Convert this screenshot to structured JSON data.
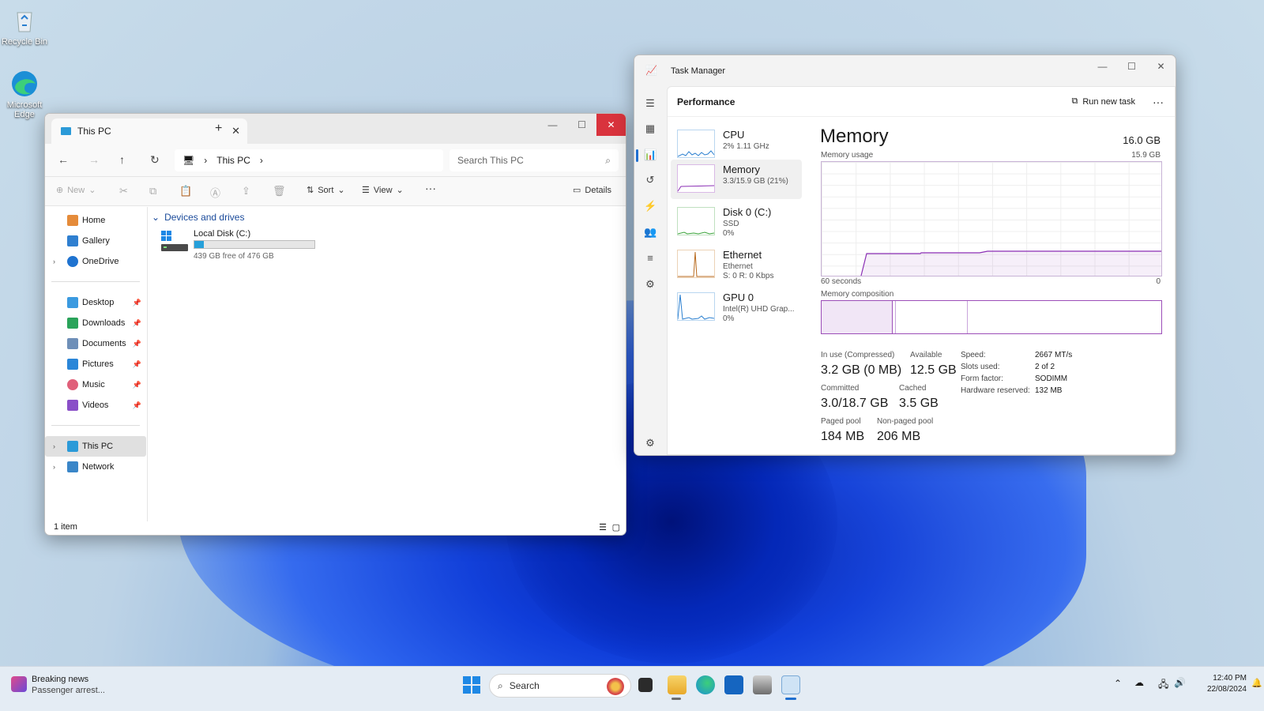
{
  "desktop": {
    "icons": [
      {
        "label": "Recycle Bin"
      },
      {
        "label": "Microsoft Edge"
      }
    ]
  },
  "explorer": {
    "tab_title": "This PC",
    "address_crumb": "This PC",
    "search_placeholder": "Search This PC",
    "commands": {
      "new": "New",
      "sort": "Sort",
      "view": "View",
      "details": "Details"
    },
    "sidebar": {
      "top": [
        "Home",
        "Gallery",
        "OneDrive"
      ],
      "pinned": [
        "Desktop",
        "Downloads",
        "Documents",
        "Pictures",
        "Music",
        "Videos"
      ],
      "bottom": [
        "This PC",
        "Network"
      ]
    },
    "group_header": "Devices and drives",
    "drive": {
      "name": "Local Disk (C:)",
      "free_text": "439 GB free of 476 GB",
      "used_fraction": 0.078
    },
    "status": "1 item"
  },
  "taskmgr": {
    "title": "Task Manager",
    "page_title": "Performance",
    "run_task": "Run new task",
    "resources": [
      {
        "name": "CPU",
        "sub1": "2% 1.11 GHz",
        "sub2": ""
      },
      {
        "name": "Memory",
        "sub1": "3.3/15.9 GB (21%)",
        "sub2": ""
      },
      {
        "name": "Disk 0 (C:)",
        "sub1": "SSD",
        "sub2": "0%"
      },
      {
        "name": "Ethernet",
        "sub1": "Ethernet",
        "sub2": "S: 0 R: 0 Kbps"
      },
      {
        "name": "GPU 0",
        "sub1": "Intel(R) UHD Grap...",
        "sub2": "0%"
      }
    ],
    "memory": {
      "heading": "Memory",
      "total": "16.0 GB",
      "usage_label": "Memory usage",
      "usage_max": "15.9 GB",
      "axis_left": "60 seconds",
      "axis_right": "0",
      "composition_label": "Memory composition",
      "in_use_label": "In use (Compressed)",
      "in_use": "3.2 GB (0 MB)",
      "available_label": "Available",
      "available": "12.5 GB",
      "committed_label": "Committed",
      "committed": "3.0/18.7 GB",
      "cached_label": "Cached",
      "cached": "3.5 GB",
      "paged_label": "Paged pool",
      "paged": "184 MB",
      "nonpaged_label": "Non-paged pool",
      "nonpaged": "206 MB",
      "speed_label": "Speed:",
      "speed": "2667 MT/s",
      "slots_label": "Slots used:",
      "slots": "2 of 2",
      "form_label": "Form factor:",
      "form": "SODIMM",
      "hwres_label": "Hardware reserved:",
      "hwres": "132 MB"
    }
  },
  "taskbar": {
    "news_title": "Breaking news",
    "news_sub": "Passenger arrest...",
    "search_label": "Search",
    "time": "12:40 PM",
    "date": "22/08/2024"
  }
}
